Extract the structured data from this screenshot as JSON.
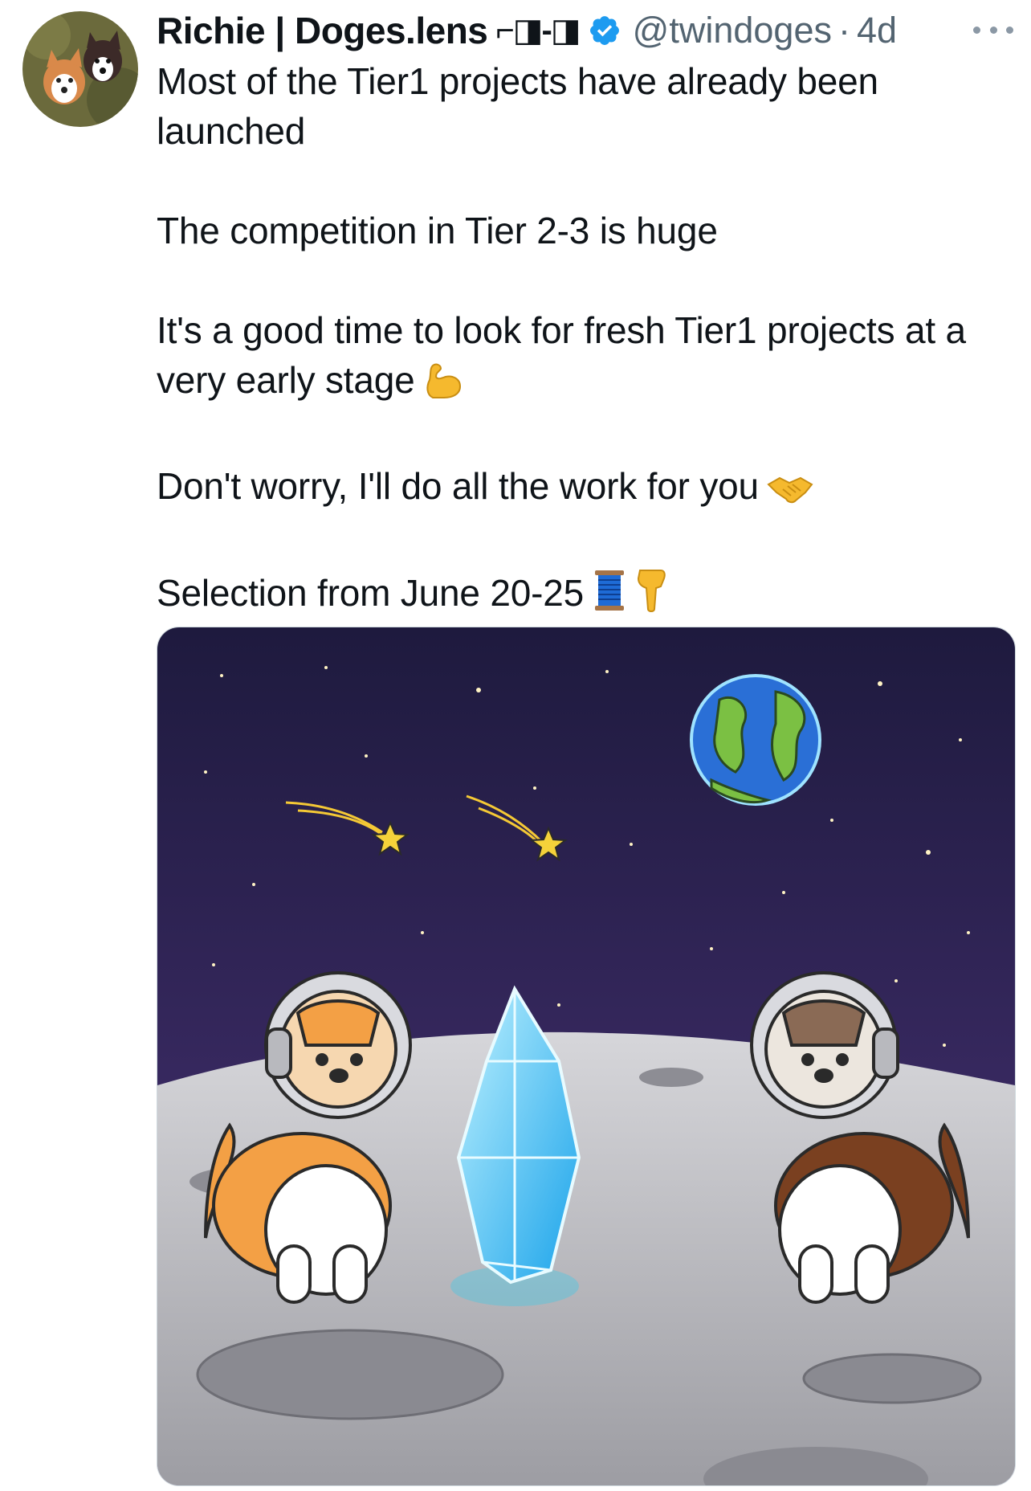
{
  "author": {
    "display_name": "Richie | Doges.lens",
    "name_decoration": "⌐◨-◨",
    "handle": "@twindoges",
    "separator": "·",
    "time": "4d",
    "verified_icon": "verified-badge-icon",
    "avatar_icon": "corgi-avatar"
  },
  "tweet": {
    "paragraphs": [
      "Most of the Tier1 projects have already been launched",
      "The competition in Tier 2-3 is huge",
      "It's a good time to look for fresh Tier1 projects at a very early stage",
      "Don't worry, I'll do all the work for you",
      "Selection from June 20-25"
    ],
    "emojis": [
      "flexed-biceps-icon",
      "handshake-icon",
      "thread-spool-icon",
      "pointing-down-icon"
    ]
  },
  "media": {
    "icon": "space-corgis-illustration"
  },
  "colors": {
    "text": "#0f1419",
    "secondary": "#536471",
    "verified": "#1d9bf0",
    "sky": "#2b1d4f",
    "moon": "#b8b8bd"
  }
}
